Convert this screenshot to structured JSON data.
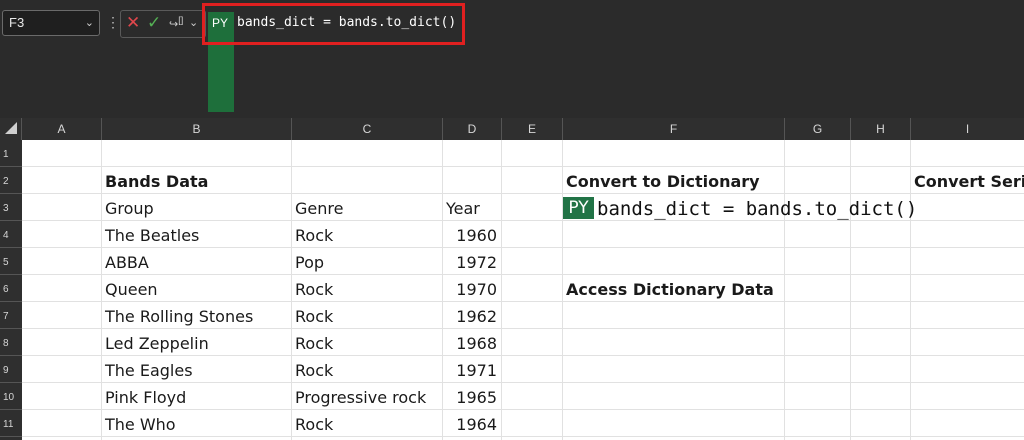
{
  "formula_bar": {
    "name_box": "F3",
    "py_badge": "PY",
    "formula": "bands_dict = bands.to_dict()"
  },
  "columns": [
    "A",
    "B",
    "C",
    "D",
    "E",
    "F",
    "G",
    "H",
    "I"
  ],
  "rows": [
    "1",
    "2",
    "3",
    "4",
    "5",
    "6",
    "7",
    "8",
    "9",
    "10",
    "11"
  ],
  "sheet": {
    "bands_title": "Bands Data",
    "headers": {
      "group": "Group",
      "genre": "Genre",
      "year": "Year"
    },
    "bands": [
      {
        "group": "The Beatles",
        "genre": "Rock",
        "year": "1960"
      },
      {
        "group": "ABBA",
        "genre": "Pop",
        "year": "1972"
      },
      {
        "group": "Queen",
        "genre": "Rock",
        "year": "1970"
      },
      {
        "group": "The Rolling Stones",
        "genre": "Rock",
        "year": "1962"
      },
      {
        "group": "Led Zeppelin",
        "genre": "Rock",
        "year": "1968"
      },
      {
        "group": "The Eagles",
        "genre": "Rock",
        "year": "1971"
      },
      {
        "group": "Pink Floyd",
        "genre": "Progressive rock",
        "year": "1965"
      },
      {
        "group": "The Who",
        "genre": "Rock",
        "year": "1964"
      }
    ],
    "convert_title": "Convert to Dictionary",
    "cell_py_badge": "PY",
    "cell_formula": "bands_dict = bands.to_dict()",
    "access_title": "Access Dictionary Data",
    "convert_series_title": "Convert Serie"
  },
  "colors": {
    "py_green": "#217346",
    "highlight_red": "#e02020"
  }
}
